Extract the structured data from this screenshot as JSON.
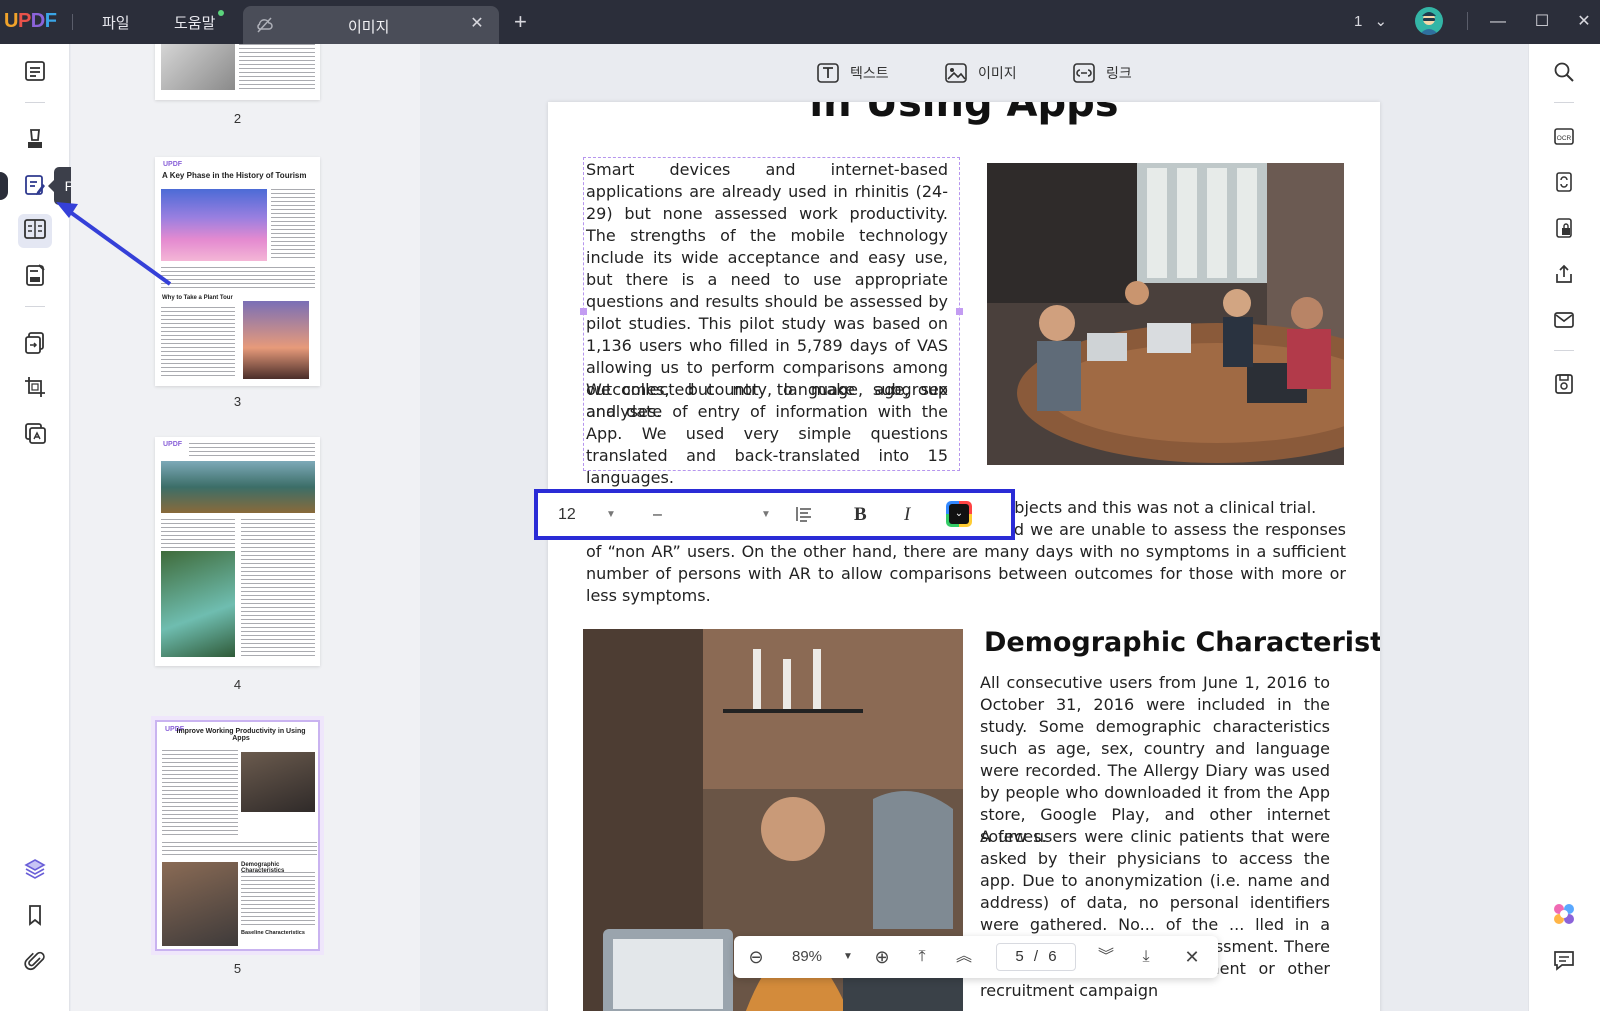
{
  "app": {
    "logo": [
      "U",
      "P",
      "D",
      "F"
    ],
    "menu": [
      "파일",
      "도움말"
    ],
    "tab_label": "이미지",
    "page_indicator": "1",
    "window_controls": [
      "minimize-icon",
      "maximize-icon",
      "close-icon"
    ]
  },
  "left_toolbar": {
    "tooltip": "PDF 편집",
    "icons": [
      "reader-icon",
      "comment-icon",
      "edit-pdf-icon",
      "organize-icon",
      "form-icon",
      "convert-icon",
      "crop-icon",
      "ocr-icon",
      "layers-icon",
      "bookmark-icon",
      "attachment-icon"
    ]
  },
  "thumbnails": [
    {
      "page": "2"
    },
    {
      "page": "3",
      "heading": "A Key Phase in the History of Tourism",
      "subheading": "Why to Take a Plant Tour"
    },
    {
      "page": "4"
    },
    {
      "page": "5",
      "heading": "Improve Working Productivity in Using Apps",
      "subheading": "Demographic Characteristics",
      "footer": "Baseline Characteristics"
    }
  ],
  "edit_tools": [
    {
      "label": "텍스트",
      "icon": "text-tool-icon"
    },
    {
      "label": "이미지",
      "icon": "image-tool-icon"
    },
    {
      "label": "링크",
      "icon": "link-tool-icon"
    }
  ],
  "page": {
    "title": "in Using Apps",
    "para1": "Smart devices and internet-based applications are already used in rhinitis (24-29) but none assessed work productivity. The strengths of the mobile technology include its wide acceptance and easy use, but there is a need to use appropriate questions and results should be assessed by pilot studies. This pilot study was based on 1,136 users who filled in 5,789 days of VAS allowing us to perform comparisons among outcomes, but not to make subgroup analyses.",
    "para2": "We collected country, language, age, sex and date of entry of information with the App. We used very simple questions translated and back-translated into 15 languages.",
    "para3_line1": "trol subjects and this was not a clinical trial.",
    "para3_rest": "Thus, as expected, over 90% users reported “AR” and we are unable to assess the responses of “non AR” users. On the other hand, there are many days with no symptoms in a sufficient number of persons with AR to allow comparisons between outcomes for those with more or less symptoms.",
    "section_title": "Demographic Characteristics",
    "para4": "All consecutive users from June 1, 2016 to October 31, 2016 were included in the study. Some demographic characteristics such as age, sex, country and language were recorded. The Allergy Diary was used by people who downloaded it from the App store, Google Play, and other internet sources.",
    "para5": "A few users were clinic patients that were asked by their physicians to access the app. Due to anonymization (i.e. name and address) of data, no personal identifiers were gathered. No... of the ... lled in a clinical ... ave a real life assessment. There was no specific advertisement or other recruitment campaign"
  },
  "format_toolbar": {
    "font_size": "12",
    "font_name": "–",
    "text_color": "#111111"
  },
  "zoom_bar": {
    "zoom": "89%",
    "current_page": "5",
    "total_pages": "6",
    "separator": "/"
  },
  "right_toolbar": {
    "icons": [
      "search-icon",
      "ocr-icon",
      "convert-icon",
      "protect-icon",
      "share-icon",
      "email-icon",
      "save-icon",
      "ai-assistant-icon",
      "chat-icon"
    ]
  },
  "colors": {
    "accent": "#2a2bd6",
    "selection": "#b696ee",
    "titlebar": "#2b2e3a"
  }
}
